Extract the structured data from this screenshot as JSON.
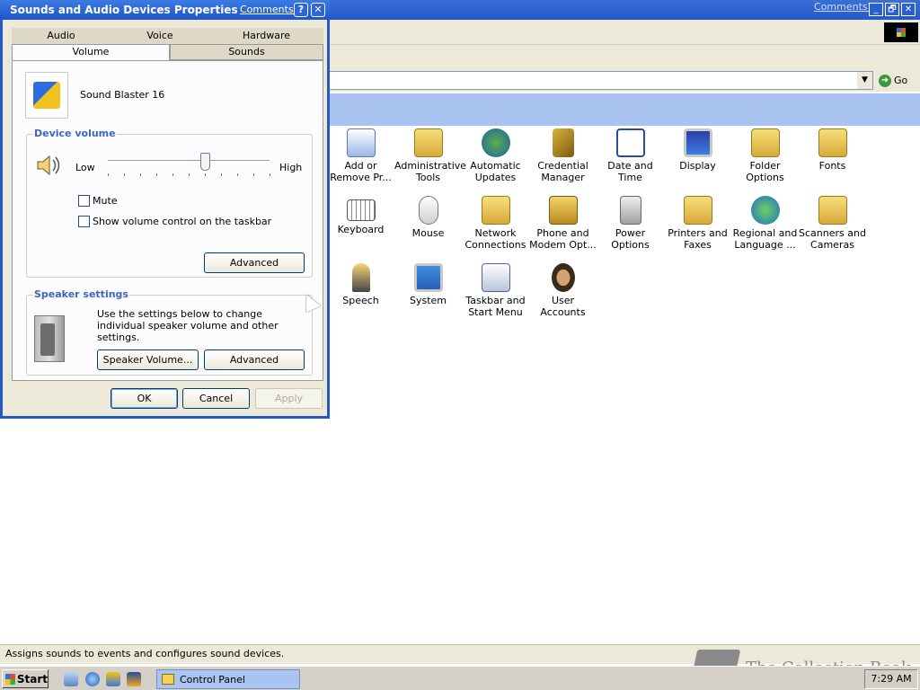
{
  "control_panel": {
    "comments_link": "Comments?",
    "window_buttons": [
      "_",
      "🗗",
      "✕"
    ],
    "go_label": "Go",
    "items_row1": [
      "Add or Remove Pr...",
      "Administrative Tools",
      "Automatic Updates",
      "Credential Manager",
      "Date and Time",
      "Display",
      "Folder Options",
      "Fonts"
    ],
    "items_row2": [
      "Keyboard",
      "Mouse",
      "Network Connections",
      "Phone and Modem Opt...",
      "Power Options",
      "Printers and Faxes",
      "Regional and Language ...",
      "Scanners and Cameras"
    ],
    "items_row3": [
      "Speech",
      "System",
      "Taskbar and Start Menu",
      "User Accounts"
    ],
    "status_text": "Assigns sounds to events and configures sound devices."
  },
  "taskbar": {
    "start_label": "Start",
    "task_label": "Control Panel",
    "clock": "7:29 AM"
  },
  "watermark": "The Collection Book",
  "dialog": {
    "title": "Sounds and Audio Devices Properties",
    "comments_link": "Comments?",
    "help_button": "?",
    "close_button": "✕",
    "tabs_top": [
      "Audio",
      "Voice",
      "Hardware"
    ],
    "tabs_bottom": [
      "Volume",
      "Sounds"
    ],
    "active_tab": "Volume",
    "device_name": "Sound Blaster 16",
    "device_volume": {
      "label": "Device volume",
      "low": "Low",
      "high": "High",
      "level": 0.6,
      "mute_label": "Mute",
      "mute_checked": false,
      "taskbar_label": "Show volume control on the taskbar",
      "taskbar_checked": false,
      "advanced_label": "Advanced"
    },
    "speaker_settings": {
      "label": "Speaker settings",
      "description": "Use the settings below to change individual speaker volume and other settings.",
      "speaker_volume_label": "Speaker Volume...",
      "advanced_label": "Advanced"
    },
    "ok_label": "OK",
    "cancel_label": "Cancel",
    "apply_label": "Apply",
    "apply_enabled": false
  },
  "colors": {
    "titlebar": "#2458c8",
    "dialog_bg": "#ece9d8",
    "group_label": "#3a66c0",
    "selection_band": "#a9c4f0"
  }
}
